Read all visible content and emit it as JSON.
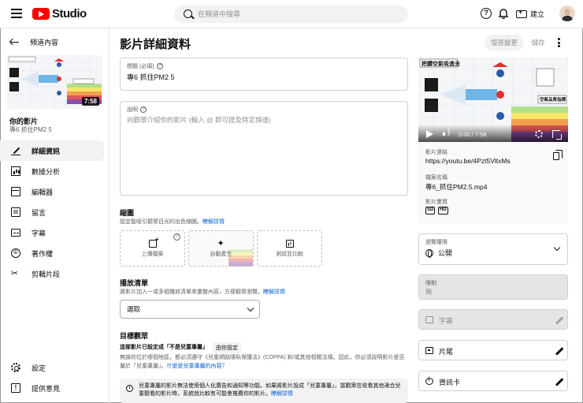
{
  "topbar": {
    "logo_text": "Studio",
    "search_placeholder": "在頻道中搜尋",
    "create_label": "建立",
    "help_glyph": "?"
  },
  "sidebar": {
    "back_label": "頻道內容",
    "thumb_duration": "7:58",
    "your_video": "你的影片",
    "video_title": "專6 抓住PM2 5",
    "nav": [
      {
        "label": "詳細資訊",
        "icon": "pencil-icon"
      },
      {
        "label": "數據分析",
        "icon": "analytics-icon"
      },
      {
        "label": "編輯器",
        "icon": "editor-icon"
      },
      {
        "label": "留言",
        "icon": "comments-icon"
      },
      {
        "label": "字幕",
        "icon": "subtitles-icon"
      },
      {
        "label": "著作權",
        "icon": "copyright-icon"
      },
      {
        "label": "剪輯片段",
        "icon": "scissors-icon"
      }
    ],
    "nav_bottom": [
      {
        "label": "設定",
        "icon": "settings-icon"
      },
      {
        "label": "提供意見",
        "icon": "feedback-icon"
      }
    ]
  },
  "header": {
    "title": "影片詳細資料",
    "undo_label": "復原變更",
    "save_label": "儲存"
  },
  "details": {
    "title_label": "標題 (必填)",
    "title_value": "專6 抓住PM2 5",
    "description_label": "說明",
    "description_placeholder": "向觀眾介紹你的影片 (輸入 @ 即可提及特定頻道)"
  },
  "thumbnail": {
    "heading": "縮圖",
    "sub": "設定能吸引觀眾目光的出色縮圖。",
    "sub_link": "瞭解詳情",
    "upload_label": "上傳檔案",
    "auto_label": "自動產生",
    "test_label": "測試並比較"
  },
  "playlist": {
    "heading": "播放清單",
    "sub": "將影片加入一或多個播放清單來彙整內容，方便觀眾瀏覽。",
    "sub_link": "瞭解詳情",
    "select_value": "選取"
  },
  "audience": {
    "heading": "目標觀眾",
    "status_text": "這部影片已設定成「不是兒童專屬」",
    "status_badge": "由你設定",
    "desc": "無論你位於哪個地區，都必須遵守《兒童網路隱私保護法》(COPPA) 和/或其他相關法規。因此，你必須說明影片是否屬於「兒童專屬」。",
    "desc_link": "什麼是兒童專屬的內容？",
    "info_text": "兒童專屬的影片無法使用個人化廣告和通知等功能。如果將影片設成「兒童專屬」，當觀眾在收看其他適合兒童觀看的影片時，系統就比較有可能會推薦你的影片。",
    "info_link": "瞭解詳情"
  },
  "preview": {
    "time": "0:00 / 7:58",
    "link_label": "影片連結",
    "link_value": "https://youtu.be/4Pzt5VltxMs",
    "filename_label": "檔案名稱",
    "filename_value": "專6_抓住PM2.5.mp4",
    "quality_label": "影片畫質",
    "quality_badges": [
      "SD",
      "HD"
    ],
    "video_caption": "把髒空氣吸進去",
    "video_caption2": "空氣品質指標"
  },
  "visibility": {
    "label": "瀏覽權限",
    "value": "公開"
  },
  "restrictions": {
    "label": "限制",
    "value": "無"
  },
  "rows": {
    "subtitles": "字幕",
    "end_screen": "片尾",
    "cards": "資訊卡"
  },
  "colors": {
    "accent": "#065fd4",
    "brand": "#ff0000"
  }
}
